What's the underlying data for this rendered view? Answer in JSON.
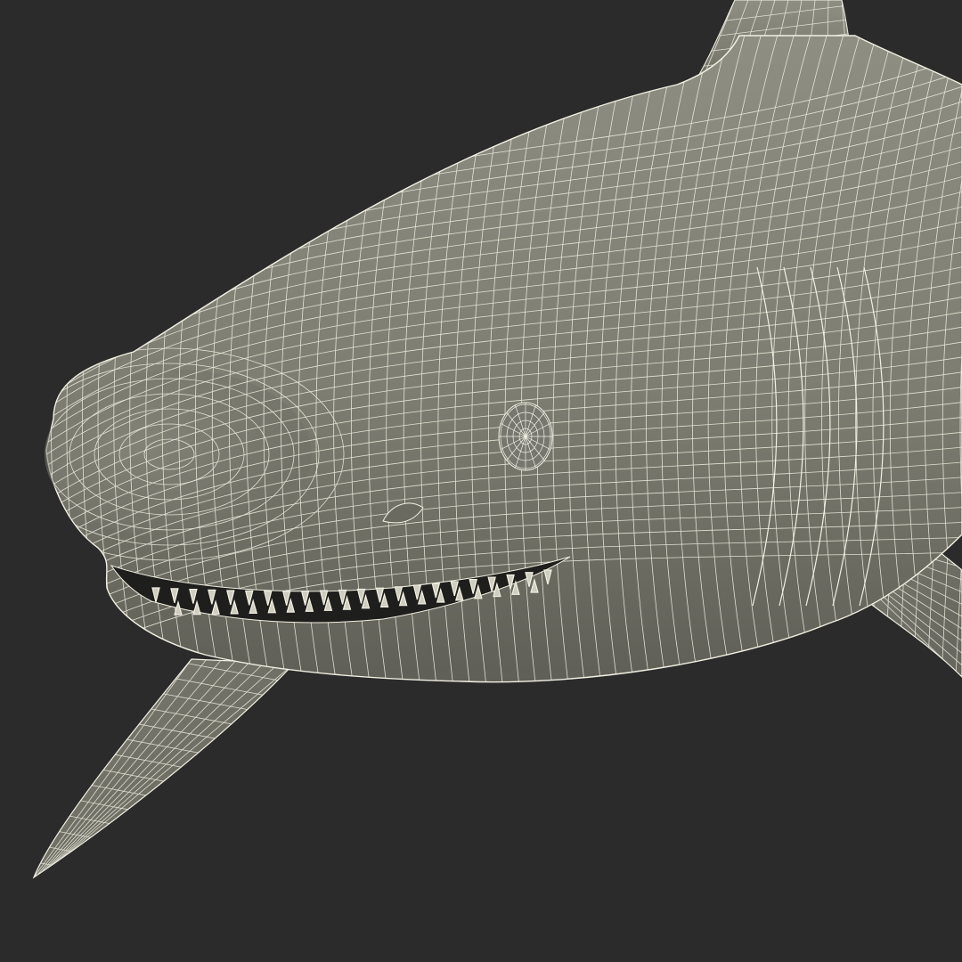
{
  "viewport": {
    "background_color": "#2b2b2b",
    "model": "shark-wireframe",
    "shading": "wireframe-on-shaded",
    "mesh_fill_color": "#7d7d72",
    "mesh_fill_highlight": "#8e8e83",
    "mesh_fill_shadow": "#5f5f57",
    "wire_color": "#f2f0e2",
    "mouth_color": "#1e1e1c",
    "visible_parts": [
      "head",
      "snout",
      "eye",
      "nostril",
      "mouth",
      "teeth",
      "dorsal-fin",
      "left-pectoral-fin",
      "right-pectoral-fin",
      "gill-slits"
    ]
  }
}
